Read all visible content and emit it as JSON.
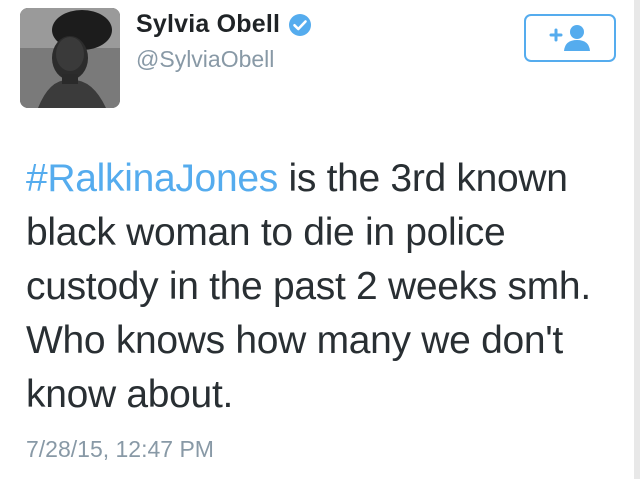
{
  "user": {
    "display_name": "Sylvia Obell",
    "handle": "@SylviaObell",
    "verified_icon": "verified-badge-icon",
    "avatar_icon": "profile-photo"
  },
  "follow_button": {
    "icon": "follow-plus-person-icon",
    "color": "#55acee"
  },
  "tweet": {
    "hashtag": "#RalkinaJones",
    "line1_rest": " is the 3rd known",
    "line2": "black woman to die in police",
    "line3": "custody in the past 2 weeks smh.",
    "line4": "Who knows how many we don't",
    "line5": "know about.",
    "timestamp": "7/28/15, 12:47 PM"
  },
  "colors": {
    "accent": "#55acee",
    "text": "#292f33",
    "muted": "#8899a6"
  }
}
